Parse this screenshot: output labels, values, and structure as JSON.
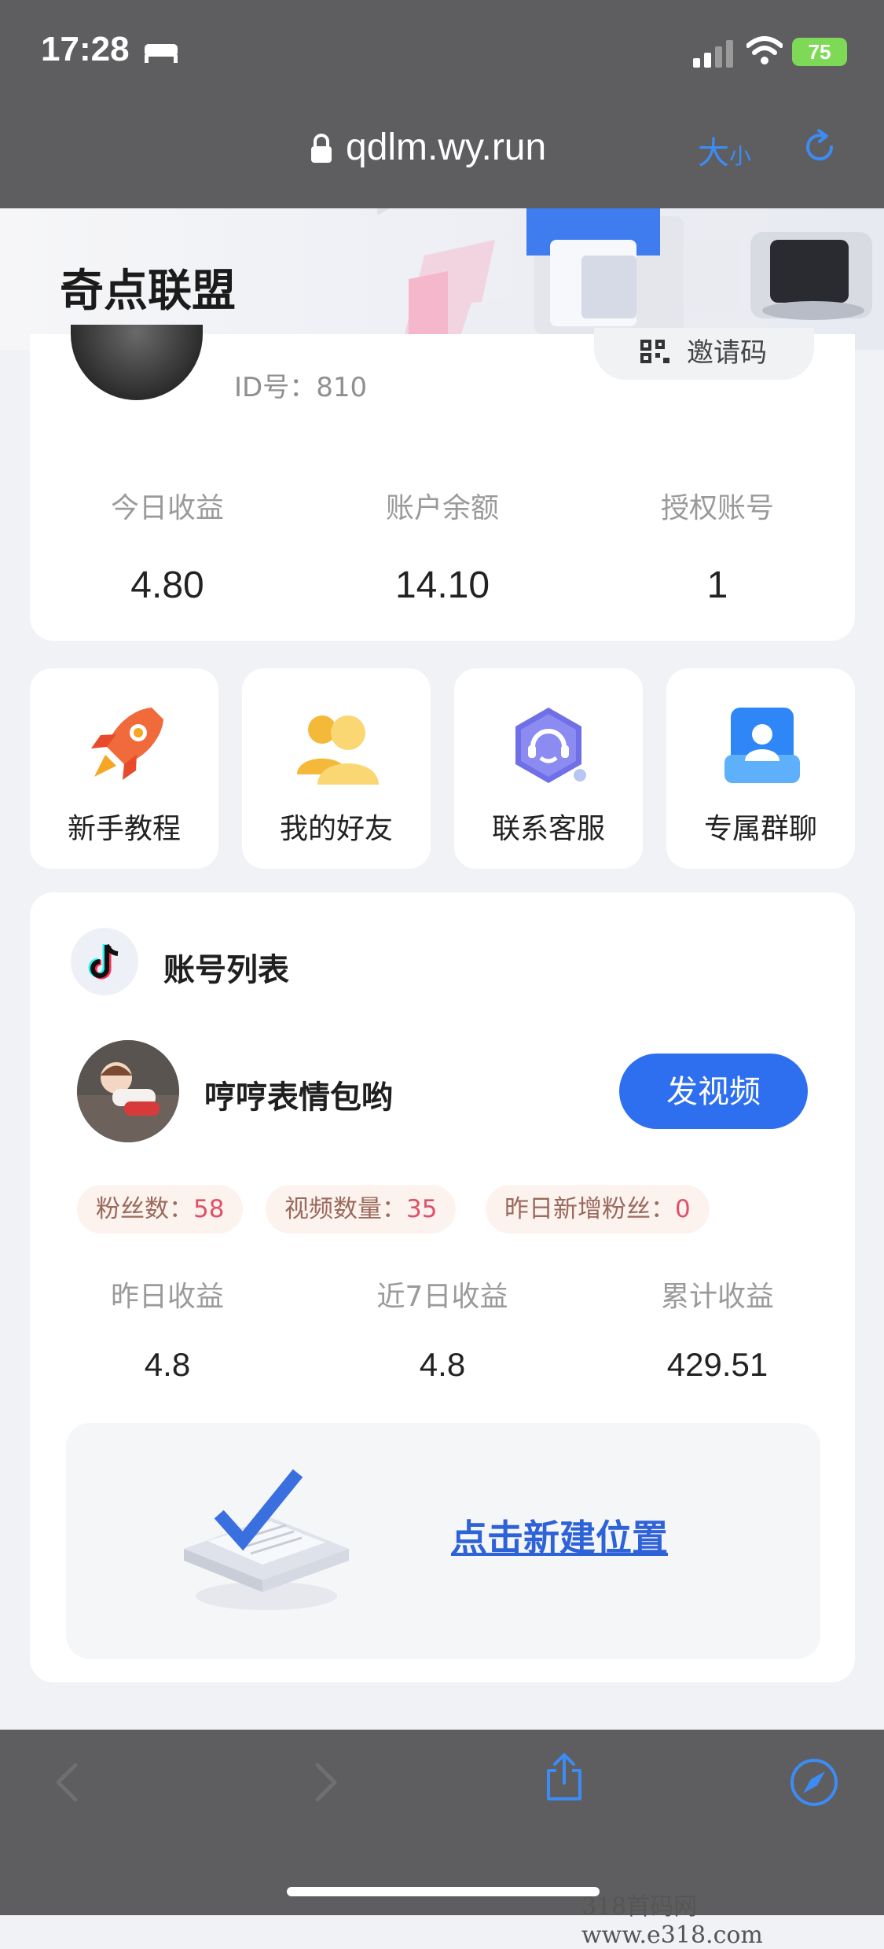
{
  "status_bar": {
    "time": "17:28",
    "battery": "75",
    "icons": [
      "bed-icon",
      "signal-icon",
      "wifi-icon",
      "battery-icon"
    ]
  },
  "browser": {
    "url": "qdlm.wy.run",
    "text_size_big": "大",
    "text_size_small": "小",
    "icons": [
      "lock-icon",
      "reload-icon",
      "back-icon",
      "forward-icon",
      "share-icon",
      "compass-icon"
    ]
  },
  "app": {
    "title": "奇点联盟"
  },
  "profile": {
    "id_label": "ID号：",
    "id_value": "810",
    "invite_label": "邀请码"
  },
  "stats": [
    {
      "label": "今日收益",
      "value": "4.80"
    },
    {
      "label": "账户余额",
      "value": "14.10"
    },
    {
      "label": "授权账号",
      "value": "1"
    }
  ],
  "tiles": [
    {
      "label": "新手教程",
      "icon": "rocket-icon"
    },
    {
      "label": "我的好友",
      "icon": "friends-icon"
    },
    {
      "label": "联系客服",
      "icon": "customer-service-icon"
    },
    {
      "label": "专属群聊",
      "icon": "group-chat-icon"
    }
  ],
  "accounts": {
    "section_title": "账号列表",
    "account_name": "哼哼表情包哟",
    "post_button": "发视频",
    "chips": [
      {
        "key": "粉丝数：",
        "value": "58"
      },
      {
        "key": "视频数量：",
        "value": "35"
      },
      {
        "key": "昨日新增粉丝：",
        "value": "0"
      }
    ],
    "earnings": [
      {
        "label": "昨日收益",
        "value": "4.8"
      },
      {
        "label": "近7日收益",
        "value": "4.8"
      },
      {
        "label": "累计收益",
        "value": "429.51"
      }
    ],
    "new_link": "点击新建位置"
  },
  "colors": {
    "accent": "#2e6ff0",
    "chip_bg": "#fdf3ee",
    "chip_value": "#e0506a",
    "browser_bar": "#5e5e60"
  },
  "watermark": "318首码网  www.e318.com"
}
